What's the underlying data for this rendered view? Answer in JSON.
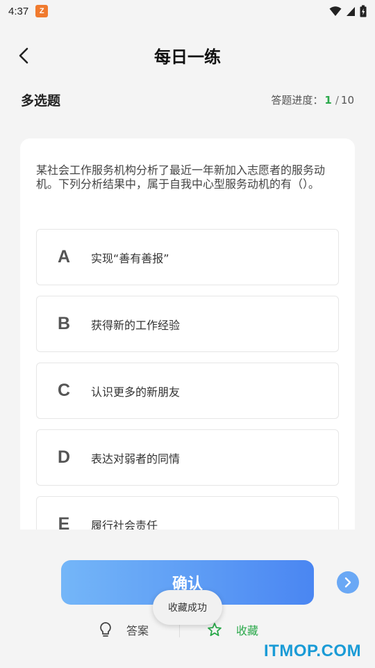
{
  "status_bar": {
    "time": "4:37",
    "app_icon_glyph": "Z"
  },
  "nav": {
    "title": "每日一练"
  },
  "question": {
    "type_label": "多选题",
    "progress_label": "答题进度：",
    "progress_current": "1",
    "progress_separator": "/",
    "progress_total": "10",
    "text": "某社会工作服务机构分析了最近一年新加入志愿者的服务动机。下列分析结果中，属于自我中心型服务动机的有（）。",
    "options": [
      {
        "letter": "A",
        "text": "实现“善有善报”"
      },
      {
        "letter": "B",
        "text": "获得新的工作经验"
      },
      {
        "letter": "C",
        "text": "认识更多的新朋友"
      },
      {
        "letter": "D",
        "text": "表达对弱者的同情"
      },
      {
        "letter": "E",
        "text": "履行社会责任"
      }
    ]
  },
  "actions": {
    "confirm_label": "确认",
    "answer_label": "答案",
    "collect_label": "收藏",
    "toast": "收藏成功"
  },
  "watermark": "ITMOP.COM",
  "colors": {
    "accent_green": "#2aa84a",
    "confirm_gradient_start": "#74b6f8",
    "confirm_gradient_end": "#4a86f2",
    "watermark_blue": "#1a9bd6"
  }
}
